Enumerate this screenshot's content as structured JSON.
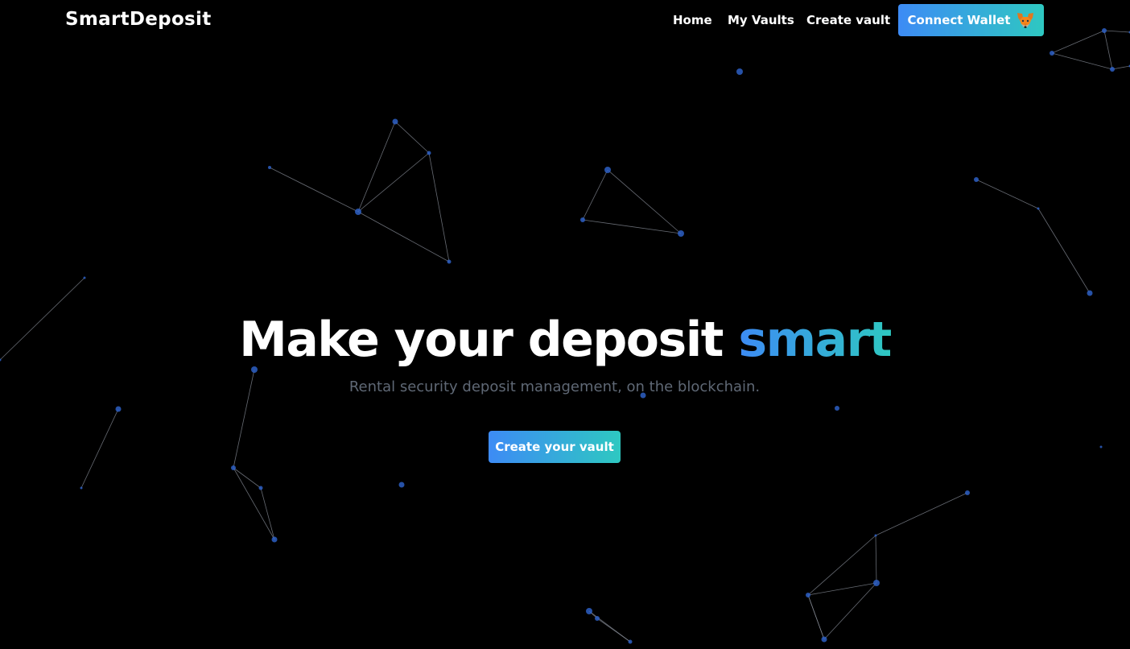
{
  "brand": {
    "name": "SmartDeposit"
  },
  "nav": {
    "items": [
      {
        "label": "Home"
      },
      {
        "label": "My Vaults"
      },
      {
        "label": "Create vault"
      }
    ],
    "connect_label": "Connect Wallet",
    "wallet_icon": "metamask-fox-icon"
  },
  "hero": {
    "title_main": "Make your deposit ",
    "title_accent": "smart",
    "subtitle": "Rental security deposit management, on the blockchain.",
    "cta_label": "Create your vault"
  },
  "colors": {
    "background": "#000000",
    "accent_start": "#3d8bf5",
    "accent_end": "#2ec8c1",
    "subtitle_text": "#5f6875",
    "particle": "#2d5fc4",
    "link_line": "#8a8f99"
  }
}
